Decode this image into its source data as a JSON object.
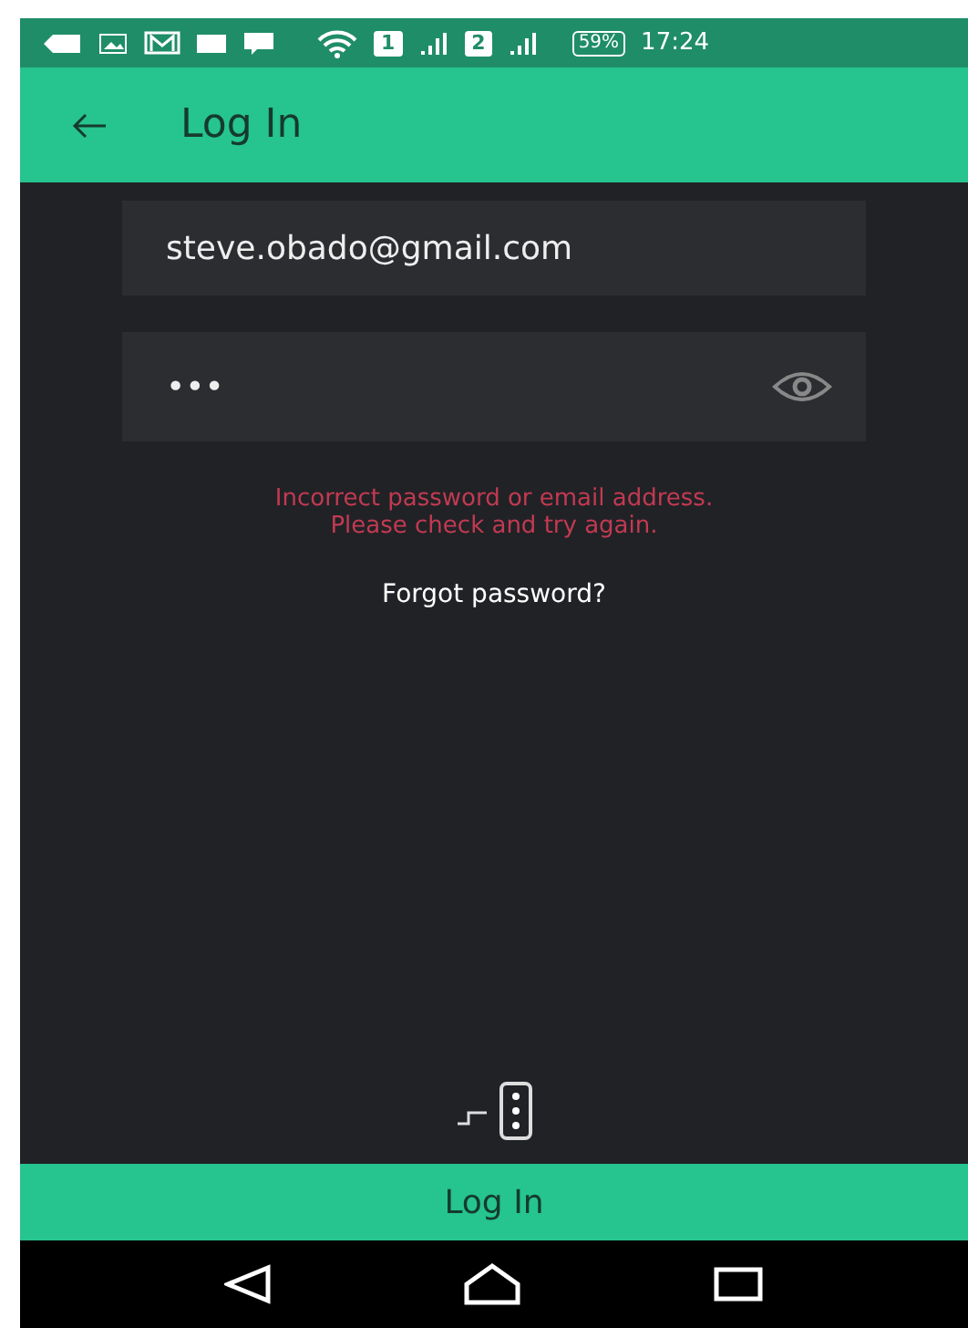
{
  "status_bar": {
    "sim_1": "1",
    "sim_2": "2",
    "battery": "59%",
    "time": "17:24"
  },
  "app_bar": {
    "title": "Log In"
  },
  "form": {
    "email": {
      "value": "steve.obado@gmail.com"
    },
    "password": {
      "value": "•••"
    },
    "error": [
      "Incorrect password or email address.",
      "Please check and try again."
    ],
    "forgot_link": "Forgot password?"
  },
  "login_button": "Log In"
}
